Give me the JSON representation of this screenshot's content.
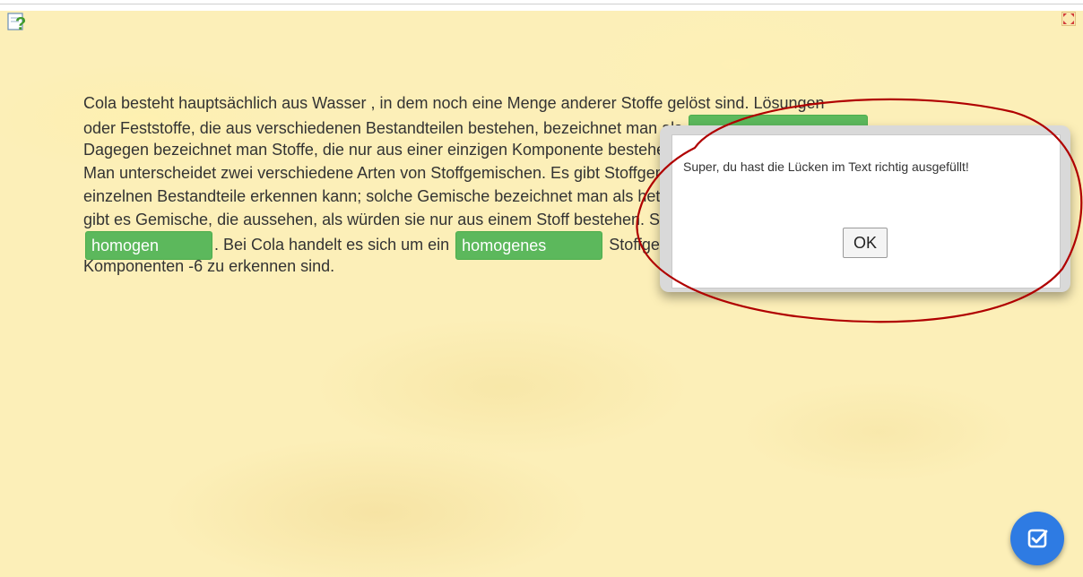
{
  "exercise": {
    "lines": [
      {
        "parts": [
          "Cola besteht hauptsächlich aus Wasser , in dem noch eine Menge anderer Stoffe gelöst sind. Lösungen"
        ]
      },
      {
        "parts": [
          "oder Feststoffe, die aus verschiedenen Bestandteilen bestehen, bezeichnet man als"
        ]
      },
      {
        "parts": [
          "Dagegen bezeichnet man Stoffe, die nur aus einer einzigen Komponente bestehen, als"
        ]
      },
      {
        "parts": [
          "Man unterscheidet zwei verschiedene Arten von Stoffgemischen. Es gibt Stoffgemische, bei denen man die"
        ]
      },
      {
        "parts": [
          "einzelnen Bestandteile erkennen kann; solche Gemische bezeichnet man als heterogen. Auf der anderen Seite"
        ]
      },
      {
        "parts": [
          "gibt es Gemische, die aussehen, als würden sie nur aus einem Stoff bestehen. Solche Gemische nennt man"
        ]
      },
      {
        "parts": [
          ". Bei Cola handelt es sich um ein",
          "Stoffgemisch, bei dem keine einzelnen"
        ]
      },
      {
        "parts": [
          "Komponenten -6 zu erkennen sind."
        ]
      }
    ],
    "gaps": {
      "homogen": "homogen",
      "homogenes": "homogenes",
      "line2": ""
    }
  },
  "dialog": {
    "message": "Super, du hast die Lücken im Text richtig ausgefüllt!",
    "ok_label": "OK"
  },
  "icons": {
    "help": "help-icon",
    "fullscreen": "fullscreen-icon",
    "check": "check-icon"
  },
  "colors": {
    "background": "#fcefb8",
    "gap_correct": "#5cb85c",
    "check_button": "#2e7be3",
    "annotation": "#b00000"
  }
}
